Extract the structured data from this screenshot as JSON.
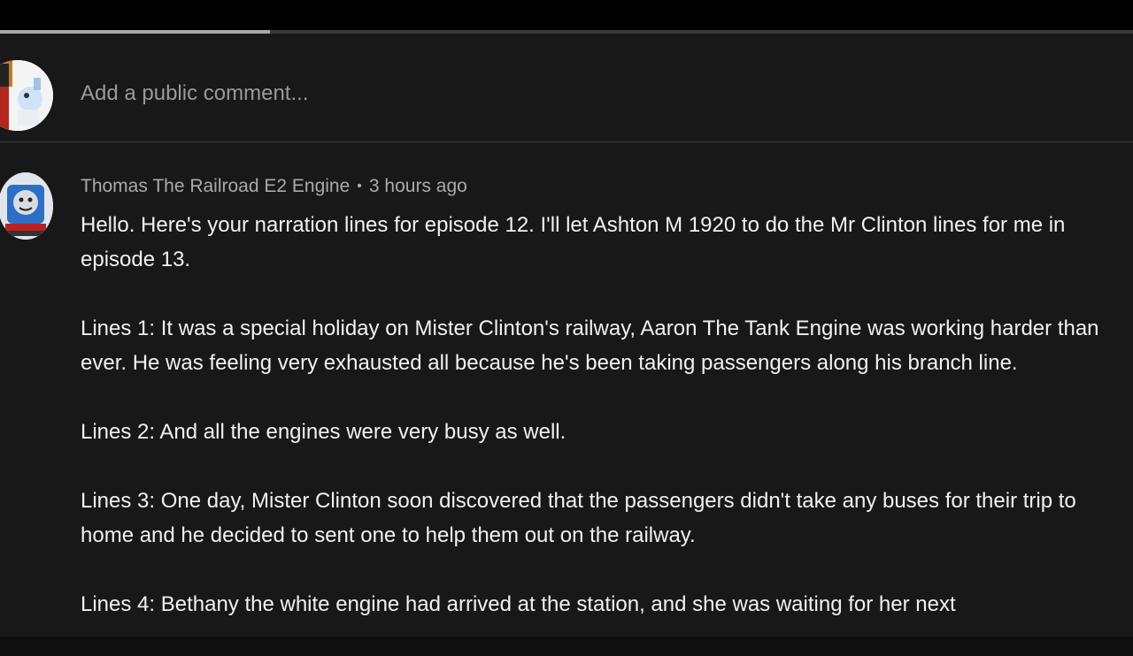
{
  "video": {
    "progress_fraction": 0.238
  },
  "comment_box": {
    "placeholder": "Add a public comment..."
  },
  "comment": {
    "author": "Thomas The Railroad E2 Engine",
    "separator": "•",
    "time": "3 hours ago",
    "paragraphs": [
      "Hello. Here's your narration lines for episode 12. I'll let Ashton M 1920 to do the Mr Clinton lines for me in episode 13.",
      "Lines 1: It was a special holiday on Mister Clinton's railway, Aaron The Tank Engine was working harder than ever. He was feeling very exhausted all because he's been taking passengers along his branch line.",
      "Lines 2: And all the engines were very busy as well.",
      "Lines 3: One day, Mister Clinton soon discovered that the passengers didn't take any buses for their trip to home and he decided to sent one to help them out on the railway.",
      "Lines 4: Bethany the white engine had arrived at the station, and she was waiting for her next"
    ]
  },
  "colors": {
    "background": "#181818",
    "text": "#f1f1f1",
    "muted": "#aaaaaa",
    "divider": "#3a3a3a"
  }
}
